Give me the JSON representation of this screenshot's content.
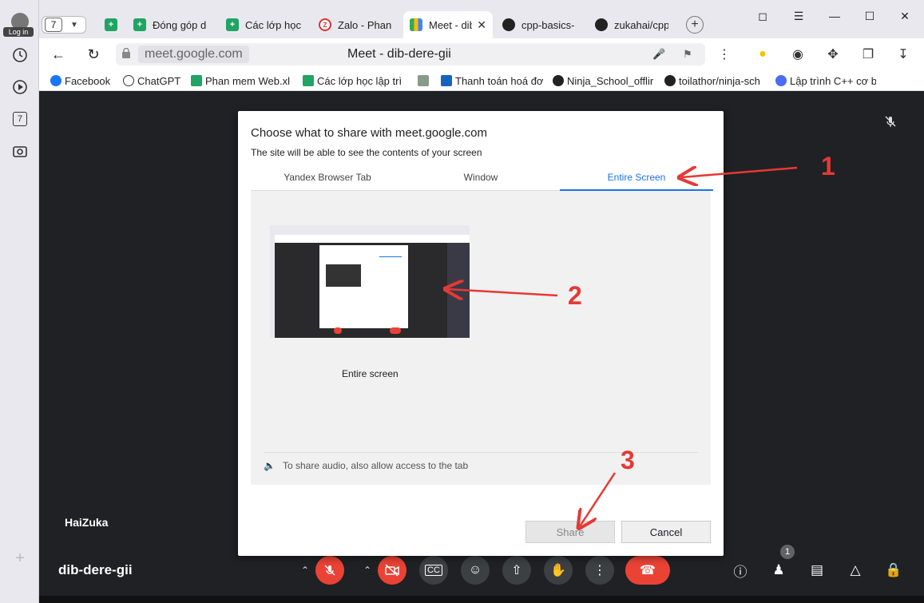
{
  "left_bar": {
    "login_label": "Log in",
    "tab_badge": "7"
  },
  "tabstrip": {
    "tab_count": "7",
    "tabs": [
      {
        "label": "Đóng góp d",
        "icon": "sheets-icon"
      },
      {
        "label": "Các lớp học",
        "icon": "sheets-icon"
      },
      {
        "label": "Zalo - Phan",
        "icon": "zalo-icon"
      },
      {
        "label": "Meet - dib",
        "icon": "meet-icon",
        "active": true
      },
      {
        "label": "cpp-basics-",
        "icon": "github-icon"
      },
      {
        "label": "zukahai/cpp",
        "icon": "github-icon"
      }
    ]
  },
  "address_bar": {
    "domain": "meet.google.com",
    "page_title": "Meet - dib-dere-gii"
  },
  "bookmarks": [
    {
      "label": "Facebook"
    },
    {
      "label": "ChatGPT"
    },
    {
      "label": "Phan mem Web.xl"
    },
    {
      "label": "Các lớp học lập trì"
    },
    {
      "label": ""
    },
    {
      "label": "Thanh toán hoá đơ"
    },
    {
      "label": "Ninja_School_offlir"
    },
    {
      "label": "toilathor/ninja-sch"
    },
    {
      "label": "Lập trình C++ cơ bả"
    }
  ],
  "dialog": {
    "title": "Choose what to share with meet.google.com",
    "subtitle": "The site will be able to see the contents of your screen",
    "tabs": [
      "Yandex Browser Tab",
      "Window",
      "Entire Screen"
    ],
    "active_tab": "Entire Screen",
    "screen_label": "Entire screen",
    "audio_note": "To share audio, also allow access to the tab",
    "share_label": "Share",
    "cancel_label": "Cancel"
  },
  "meet": {
    "participant_name": "HaiZuka",
    "meeting_code": "dib-dere-gii",
    "people_count": "1"
  },
  "annotations": [
    "1",
    "2",
    "3"
  ],
  "colors": {
    "accent": "#1a73e8",
    "annotation": "#e53935",
    "hangup": "#ea4335"
  }
}
